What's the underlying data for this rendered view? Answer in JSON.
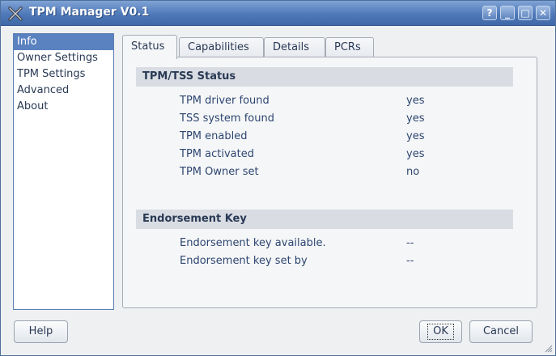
{
  "window": {
    "title": "TPM Manager V0.1"
  },
  "titlebar_buttons": {
    "help": "?",
    "minimize": "_",
    "maximize": "□",
    "close": "✕"
  },
  "sidebar": {
    "items": [
      {
        "label": "Info",
        "active": true
      },
      {
        "label": "Owner Settings",
        "active": false
      },
      {
        "label": "TPM Settings",
        "active": false
      },
      {
        "label": "Advanced",
        "active": false
      },
      {
        "label": "About",
        "active": false
      }
    ]
  },
  "tabs": [
    {
      "label": "Status",
      "active": true
    },
    {
      "label": "Capabilities",
      "active": false
    },
    {
      "label": "Details",
      "active": false
    },
    {
      "label": "PCRs",
      "active": false
    }
  ],
  "status": {
    "section_title": "TPM/TSS Status",
    "rows": [
      {
        "label": "TPM driver found",
        "value": "yes"
      },
      {
        "label": "TSS system found",
        "value": "yes"
      },
      {
        "label": "TPM enabled",
        "value": "yes"
      },
      {
        "label": "TPM activated",
        "value": "yes"
      },
      {
        "label": "TPM Owner set",
        "value": "no"
      }
    ]
  },
  "endorsement": {
    "section_title": "Endorsement Key",
    "rows": [
      {
        "label": "Endorsement key available.",
        "value": "--"
      },
      {
        "label": "Endorsement key set by",
        "value": "--"
      }
    ]
  },
  "buttons": {
    "help": "Help",
    "ok": "OK",
    "cancel": "Cancel"
  },
  "colors": {
    "titlebar": "#4f79b8",
    "selection": "#5a82c0",
    "section_header": "#d9dde3"
  }
}
